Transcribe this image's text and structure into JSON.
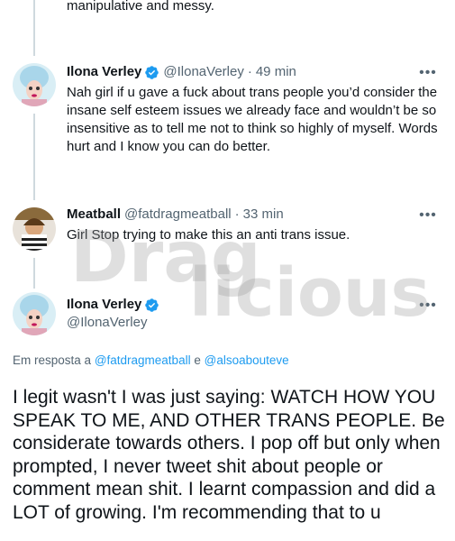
{
  "previous_tweet": {
    "text_tail": "manipulative and messy."
  },
  "tweets": [
    {
      "display_name": "Ilona Verley",
      "handle": "@IlonaVerley",
      "separator": "·",
      "time": "49 min",
      "verified": true,
      "text": "Nah girl if u gave a fuck about trans people you’d consider the insane self esteem issues we already face and wouldn’t be so insensitive as to tell me not to think so highly of myself. Words hurt and I know you can do better."
    },
    {
      "display_name": "Meatball",
      "handle": "@fatdragmeatball",
      "separator": "·",
      "time": "33 min",
      "verified": false,
      "text": "Girl Stop trying to make this an anti trans issue."
    }
  ],
  "focused_tweet": {
    "display_name": "Ilona Verley",
    "handle": "@IlonaVerley",
    "verified": true,
    "reply_prefix": "Em resposta a",
    "reply_mention_1": "@fatdragmeatball",
    "reply_join": "e",
    "reply_mention_2": "@alsoabouteve",
    "text": "I legit wasn't I was just saying: WATCH HOW YOU SPEAK TO ME, AND OTHER TRANS PEOPLE. Be considerate towards others. I pop off but only when prompted, I never tweet shit about people or comment mean shit. I learnt compassion and did a LOT of growing. I'm recommending that to u"
  },
  "more_label": "•••",
  "watermark": {
    "text_1": "Drag",
    "text_2": "licious"
  },
  "colors": {
    "accent": "#1d9bf0",
    "secondary_text": "#536471",
    "thread_line": "#cfd9de"
  },
  "icons": {
    "verified": "verified-badge-icon",
    "more": "more-options-icon"
  }
}
